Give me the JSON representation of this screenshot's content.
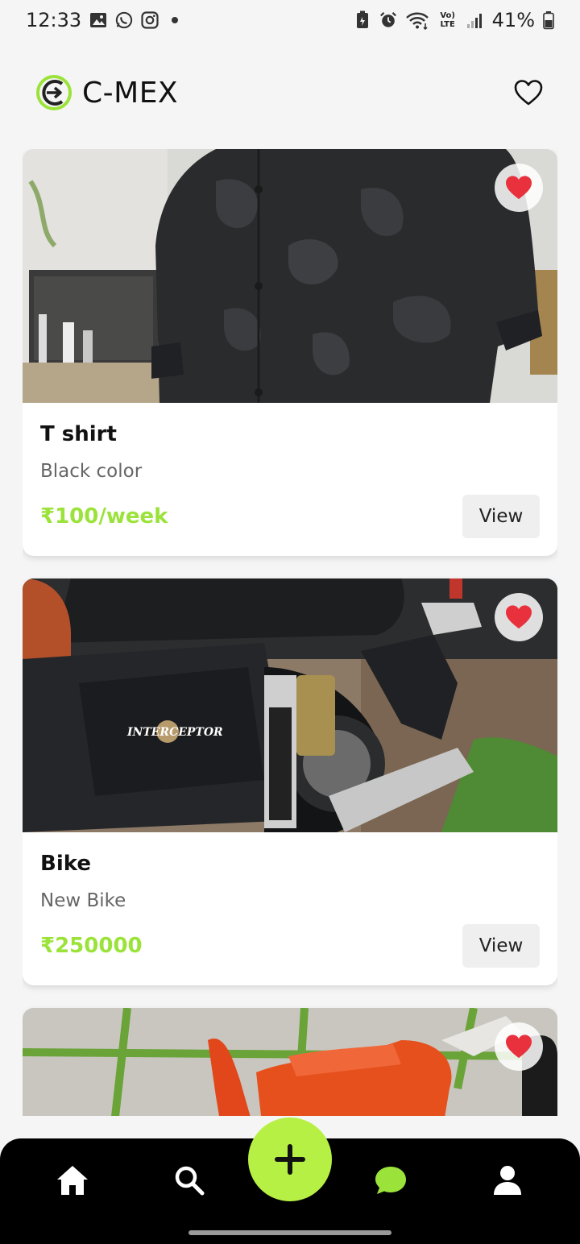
{
  "status_bar": {
    "time": "12:33",
    "battery": "41%",
    "network_label": "Vo) LTE",
    "left_icons": [
      "gallery-icon",
      "whatsapp-icon",
      "instagram-icon",
      "notification-dot"
    ],
    "right_icons": [
      "battery-saver-icon",
      "alarm-icon",
      "wifi-icon",
      "volte-icon",
      "signal-icon",
      "battery-icon"
    ]
  },
  "header": {
    "app_name": "C-MEX",
    "logo_icon": "c-mex-logo-icon",
    "favorites_icon": "heart-outline-icon"
  },
  "listings": [
    {
      "title": "T shirt",
      "description": "Black color",
      "price": "₹100/week",
      "action": "View",
      "favorited": true,
      "image": "black camouflage shirt"
    },
    {
      "title": "Bike",
      "description": "New Bike",
      "price": "₹250000",
      "action": "View",
      "favorited": true,
      "image": "motorcycle side panel",
      "image_badge_text": "INTERCEPTOR"
    },
    {
      "title": "",
      "description": "",
      "price": "",
      "action": "",
      "favorited": true,
      "image": "orange shoes on tiles"
    }
  ],
  "bottom_nav": {
    "items": [
      "home-icon",
      "search-icon",
      "add-icon",
      "chat-icon",
      "profile-icon"
    ],
    "active_color": "#9be33a",
    "fab_color": "#b7f044"
  },
  "colors": {
    "accent": "#9be33a",
    "heart": "#e8313d",
    "nav_bg": "#000000"
  }
}
